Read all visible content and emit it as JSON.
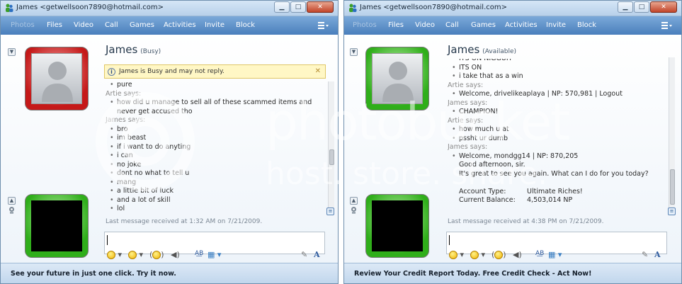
{
  "left": {
    "title": "James <getwellsoon7890@hotmail.com>",
    "menu": [
      "Photos",
      "Files",
      "Video",
      "Call",
      "Games",
      "Activities",
      "Invite",
      "Block"
    ],
    "contact_name": "James",
    "contact_status": "(Busy)",
    "busy_notice": "James is Busy and may not reply.",
    "chat": [
      {
        "t": "b",
        "s": "pure"
      },
      {
        "t": "h",
        "s": "Artie says:"
      },
      {
        "t": "b",
        "s": "how did u manage to sell all of these scammed items and"
      },
      {
        "t": "c",
        "s": "never get accused tho"
      },
      {
        "t": "h",
        "s": "James says:"
      },
      {
        "t": "b",
        "s": "bro"
      },
      {
        "t": "b",
        "s": "im beast"
      },
      {
        "t": "b",
        "s": "if i want to do anyting"
      },
      {
        "t": "b",
        "s": "i can"
      },
      {
        "t": "b",
        "s": "no joke"
      },
      {
        "t": "b",
        "s": "dont no what to tell u"
      },
      {
        "t": "b",
        "s": "mang"
      },
      {
        "t": "b",
        "s": "a little bit of luck"
      },
      {
        "t": "b",
        "s": "and a lot of skill"
      },
      {
        "t": "b",
        "s": "lol"
      }
    ],
    "last_message": "Last message received at 1:32 AM on 7/21/2009.",
    "ad": "See your future in just one click.  Try it now."
  },
  "right": {
    "title": "James <getwellsoon7890@hotmail.com>",
    "menu": [
      "Photos",
      "Files",
      "Video",
      "Call",
      "Games",
      "Activities",
      "Invite",
      "Block"
    ],
    "contact_name": "James",
    "contact_status": "(Available)",
    "chat": [
      {
        "t": "b",
        "s": "ITS ON NIGGUH"
      },
      {
        "t": "b",
        "s": "ITS ON"
      },
      {
        "t": "b",
        "s": "i take that as a win"
      },
      {
        "t": "h",
        "s": "Artie says:"
      },
      {
        "t": "b",
        "s": "Welcome, drivelikeaplaya | NP: 570,981 | Logout"
      },
      {
        "t": "h",
        "s": "James says:"
      },
      {
        "t": "b",
        "s": "CHAMPION!"
      },
      {
        "t": "h",
        "s": "Artie says:"
      },
      {
        "t": "b",
        "s": "how much u at"
      },
      {
        "t": "b",
        "s": "pssht ur dumb"
      },
      {
        "t": "h",
        "s": "James says:"
      },
      {
        "t": "b",
        "s": "Welcome, mondgg14 | NP: 870,205"
      },
      {
        "t": "c",
        "s": "Good afternoon, sir."
      },
      {
        "t": "c",
        "s": "It's great to see you again. What can I do for you today?"
      }
    ],
    "account_type_label": "Account Type:",
    "account_type_value": "Ultimate Riches!",
    "balance_label": "Current Balance:",
    "balance_value": "4,503,014 NP",
    "last_message": "Last message received at 4:38 PM on 7/21/2009.",
    "ad": "Review Your Credit Report Today.  Free Credit Check - Act Now!"
  },
  "watermark": {
    "brand": "photobucket",
    "tagline": "host. store. share."
  }
}
